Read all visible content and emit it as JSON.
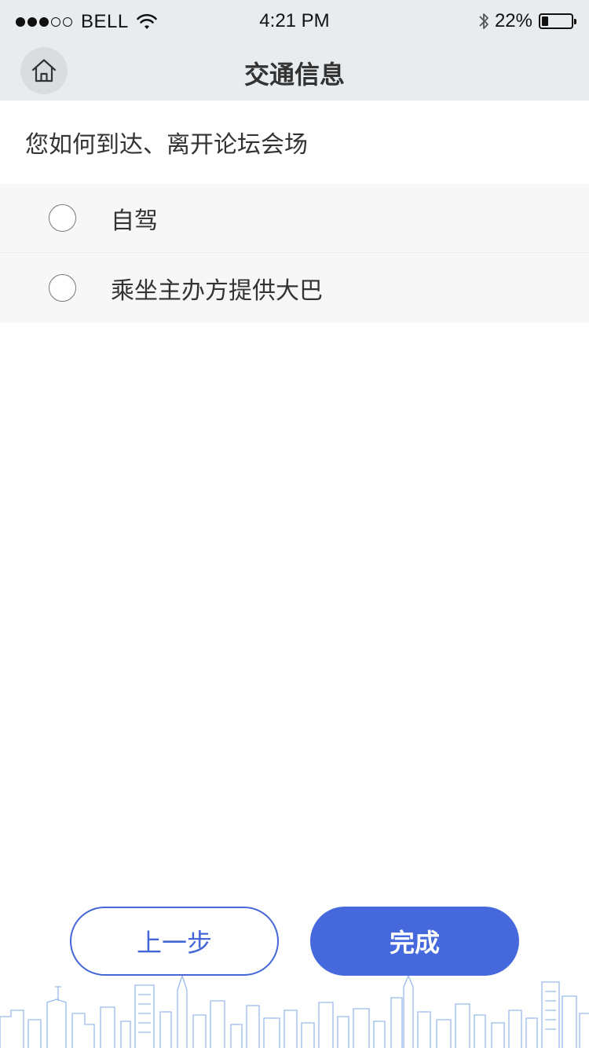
{
  "status_bar": {
    "carrier": "BELL",
    "time": "4:21 PM",
    "battery_percent": "22%",
    "battery_level": 0.22,
    "signal_strength": 3,
    "signal_max": 5
  },
  "nav": {
    "title": "交通信息",
    "home_icon": "home-icon"
  },
  "question": "您如何到达、离开论坛会场",
  "options": [
    {
      "label": "自驾",
      "selected": false
    },
    {
      "label": "乘坐主办方提供大巴",
      "selected": false
    }
  ],
  "actions": {
    "prev_label": "上一步",
    "done_label": "完成"
  },
  "colors": {
    "accent": "#4568dc",
    "header_bg": "#e8ecef",
    "option_bg": "#f7f7f7",
    "skyline": "#7fa6e8"
  }
}
